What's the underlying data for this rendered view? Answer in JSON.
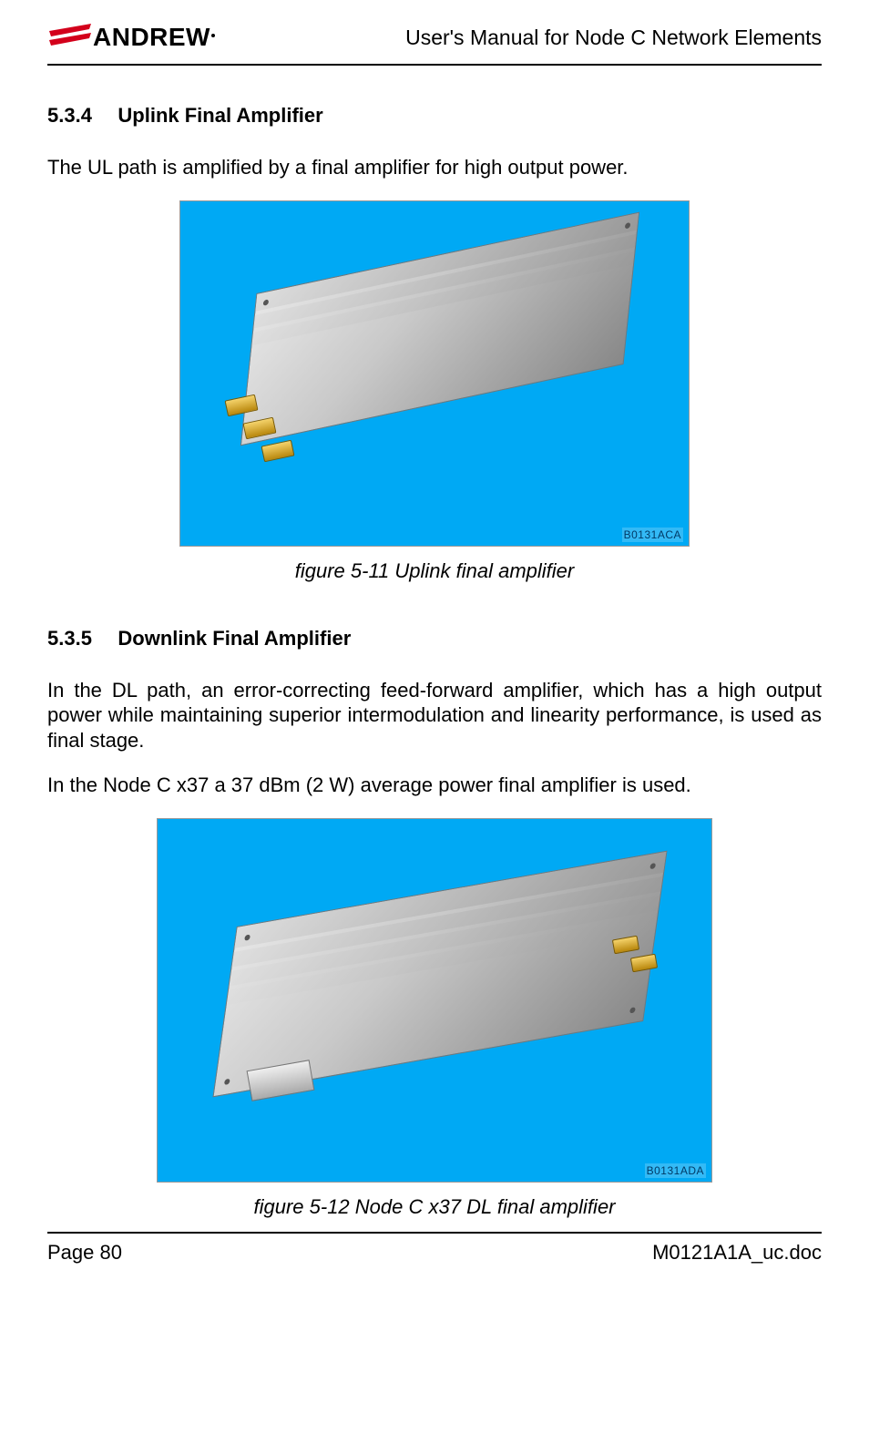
{
  "header": {
    "logo_text": "ANDREW",
    "doc_title": "User's Manual for Node C Network Elements"
  },
  "sections": {
    "s1": {
      "num": "5.3.4",
      "title": "Uplink Final Amplifier",
      "para1": "The UL path is amplified by a final amplifier for high output power."
    },
    "s2": {
      "num": "5.3.5",
      "title": "Downlink Final Amplifier",
      "para1": "In the DL path, an error-correcting feed-forward amplifier, which has a high output power while maintaining superior intermodulation and linearity performance, is used as final stage.",
      "para2": "In the Node C x37 a 37 dBm (2 W) average power final amplifier is used."
    }
  },
  "figures": {
    "f1": {
      "tag": "B0131ACA",
      "caption": "figure 5-11 Uplink final amplifier"
    },
    "f2": {
      "tag": "B0131ADA",
      "caption": "figure 5-12 Node C x37 DL final amplifier"
    }
  },
  "footer": {
    "page_label": "Page 80",
    "doc_ref": "M0121A1A_uc.doc"
  }
}
